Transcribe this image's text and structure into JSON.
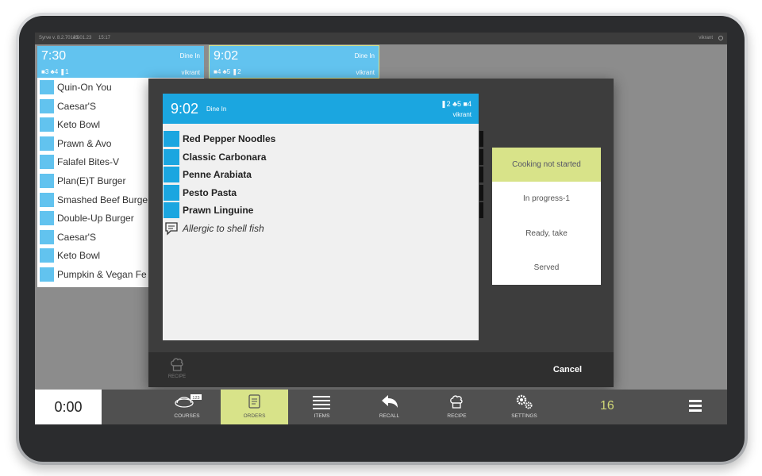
{
  "statusbar": {
    "version": "Syrve v. 8.2.7014.0",
    "date": "25.01.23",
    "time": "15:17",
    "user": "vikrant"
  },
  "tickets": [
    {
      "time": "7:30",
      "type": "Dine In",
      "counts": "■3 ♣4 ❚1",
      "user": "vikrant",
      "items": [
        "Quin-On You",
        "Caesar'S",
        "Keto Bowl",
        "Prawn & Avo",
        "Falafel Bites-V",
        "Plan(E)T Burger",
        "Smashed Beef Burger",
        "Double-Up Burger",
        "Caesar'S",
        "Keto Bowl",
        "Pumpkin & Vegan Fe"
      ]
    },
    {
      "time": "9:02",
      "type": "Dine In",
      "counts": "■4 ♣5 ❚2",
      "user": "vikrant"
    }
  ],
  "modal": {
    "time": "9:02",
    "type": "Dine In",
    "counts": "❚2 ♣5 ■4",
    "user": "vikrant",
    "items": [
      "Red Pepper Noodles",
      "Classic Carbonara",
      "Penne Arabiata",
      "Pesto Pasta",
      "Prawn Linguine"
    ],
    "note": "Allergic to shell fish",
    "status_options": [
      "Cooking not started",
      "In progress-1",
      "Ready, take",
      "Served"
    ],
    "recipe_label": "RECIPE",
    "cancel_label": "Cancel"
  },
  "bottombar": {
    "timer": "0:00",
    "nav": [
      "COURSES",
      "ORDERS",
      "ITEMS",
      "RECALL",
      "RECIPE",
      "SETTINGS"
    ],
    "courses_badge": "123",
    "count": "16"
  },
  "colors": {
    "ticket_blue": "#62c3ef",
    "modal_blue": "#1ba6e0",
    "active_green": "#d8e389",
    "count_text": "#cfd676"
  },
  "icons": [
    "help-icon",
    "chef-hat-icon",
    "dish-icon",
    "order-sheet-icon",
    "list-icon",
    "recall-arrow-icon",
    "gear-icon",
    "comment-icon",
    "menu-icon"
  ]
}
